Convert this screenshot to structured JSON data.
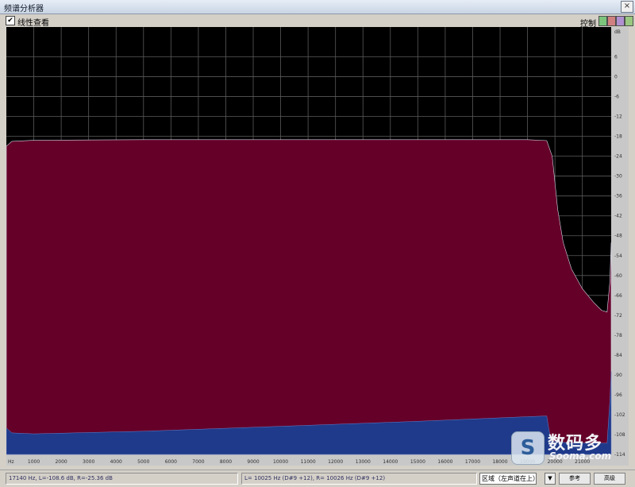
{
  "window": {
    "title": "频谱分析器",
    "close_glyph": "×"
  },
  "toolbar": {
    "checkbox_checked": true,
    "checkbox_label": "线性查看",
    "control_label": "控制",
    "swatches": [
      {
        "color": "#7cc47c"
      },
      {
        "color": "#d08080"
      },
      {
        "color": "#b090d0"
      },
      {
        "color": "#9ac880"
      }
    ]
  },
  "colors": {
    "background": "#000000",
    "grid": "#5a5a5a",
    "left_channel": "#650029",
    "right_channel": "#1f3a8a",
    "edge": "#d8d8e8"
  },
  "chart_data": {
    "type": "area",
    "x_unit": "Hz",
    "x_range": [
      0,
      22050
    ],
    "x_ticks": [
      "Hz",
      "1000",
      "2000",
      "3000",
      "4000",
      "5000",
      "6000",
      "7000",
      "8000",
      "9000",
      "10000",
      "11000",
      "12000",
      "13000",
      "14000",
      "15000",
      "16000",
      "17000",
      "18000",
      "19000",
      "20000",
      "21000"
    ],
    "y_range": [
      -120,
      9
    ],
    "y_ticks": [
      "dB",
      "6",
      "0",
      "-6",
      "-12",
      "-18",
      "-24",
      "-30",
      "-36",
      "-42",
      "-48",
      "-54",
      "-60",
      "-66",
      "-72",
      "-78",
      "-84",
      "-90",
      "-96",
      "-102",
      "-108",
      "-114"
    ],
    "grid": true,
    "series": [
      {
        "points": [
          [
            0,
            -27
          ],
          [
            200,
            -25.5
          ],
          [
            1000,
            -25.2
          ],
          [
            5000,
            -25
          ],
          [
            10000,
            -25
          ],
          [
            15000,
            -25
          ],
          [
            19000,
            -25
          ],
          [
            19700,
            -25.3
          ],
          [
            19900,
            -30
          ],
          [
            20100,
            -46
          ],
          [
            20300,
            -56
          ],
          [
            20600,
            -64
          ],
          [
            21000,
            -70
          ],
          [
            21400,
            -74
          ],
          [
            21700,
            -76.5
          ],
          [
            21900,
            -77
          ],
          [
            22000,
            -68
          ],
          [
            22050,
            -56
          ]
        ]
      },
      {
        "points": [
          [
            0,
            -112
          ],
          [
            200,
            -113.5
          ],
          [
            1000,
            -113.8
          ],
          [
            5000,
            -113
          ],
          [
            10000,
            -111.5
          ],
          [
            15000,
            -110
          ],
          [
            19000,
            -108.6
          ],
          [
            19700,
            -108.4
          ],
          [
            19850,
            -116
          ],
          [
            20500,
            -116.5
          ],
          [
            21500,
            -116.6
          ],
          [
            21900,
            -116.6
          ],
          [
            22000,
            -104
          ],
          [
            22050,
            -95
          ]
        ]
      }
    ]
  },
  "status": {
    "cursor": "17140 Hz, L=-108.6 dB, R=-25.36 dB",
    "peak": "L= 10025 Hz (D#9 +12), R= 10026 Hz (D#9 +12)",
    "mode_select": "区域（左声道在上）",
    "button1": "参考",
    "button2": "高级"
  },
  "watermark": {
    "logo_letter": "S",
    "name": "数码多",
    "url": "Sooma.com"
  }
}
